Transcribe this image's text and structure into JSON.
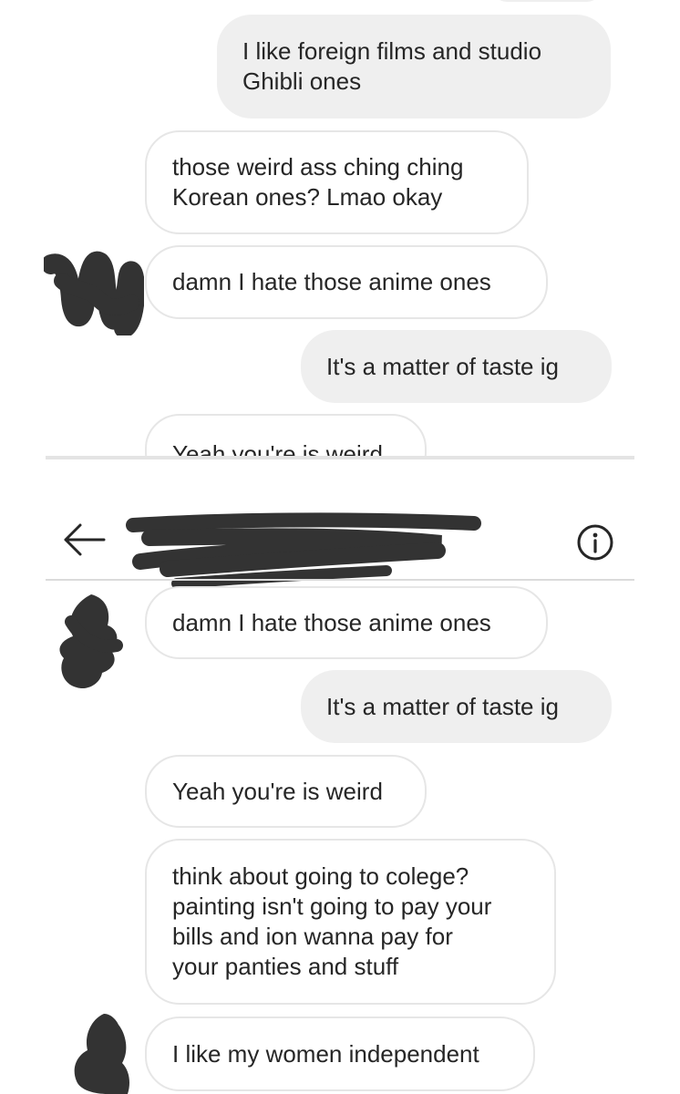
{
  "top_panel": {
    "messages": [
      {
        "side": "sent",
        "text": "I like foreign films and studio\nGhibli ones"
      },
      {
        "side": "received",
        "text": "those weird ass ching ching\nKorean ones? Lmao okay"
      },
      {
        "side": "received",
        "text": "damn I hate those anime ones"
      },
      {
        "side": "sent",
        "text": "It's a matter of taste ig"
      },
      {
        "side": "received",
        "text": "Yeah you're is weird"
      }
    ]
  },
  "bottom_panel": {
    "header": {
      "back_icon": "arrow-left-icon",
      "info_icon": "info-circle-icon"
    },
    "messages": [
      {
        "side": "received",
        "text": "damn I hate those anime ones"
      },
      {
        "side": "sent",
        "text": "It's a matter of taste ig"
      },
      {
        "side": "received",
        "text": "Yeah you're is weird"
      },
      {
        "side": "received",
        "text": "think about going to colege?\npainting isn't going to pay your\nbills and ion wanna pay for\nyour panties and stuff"
      },
      {
        "side": "received",
        "text": "I like my women independent"
      }
    ]
  },
  "colors": {
    "sent_bubble": "#efefef",
    "received_border": "#e6e6e6",
    "text": "#262626",
    "redaction": "#333333"
  }
}
